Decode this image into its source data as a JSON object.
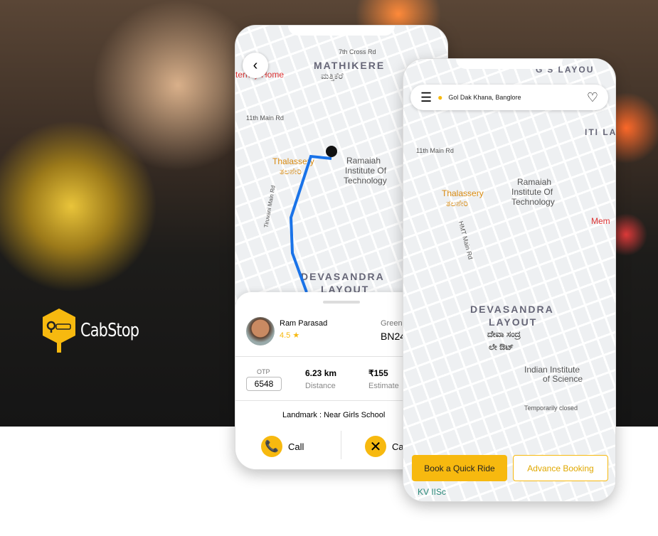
{
  "brand": {
    "name": "CabStop",
    "accent": "#f7b90f"
  },
  "phone1": {
    "map_labels": [
      "MATHIKERE",
      "ಮತ್ತಿಕೆರೆ",
      "Thalassery",
      "ತಲಶೇರಿ",
      "Ramaiah",
      "Institute Of",
      "Technology",
      "DEVASANDRA",
      "LAYOUT",
      "11th Main Rd",
      "7th Cross Rd",
      "Tiruvani Main Rd",
      "ternity Home"
    ],
    "driver": {
      "name": "Ram Parasad",
      "rating": "4.5",
      "car_color": "Green",
      "plate": "BN24"
    },
    "otp_label": "OTP",
    "otp": "6548",
    "distance": "6.23 km",
    "distance_label": "Distance",
    "estimate": "₹155",
    "estimate_label": "Estimate",
    "landmark": "Landmark : Near Girls School",
    "call_label": "Call",
    "cancel_label": "Ca"
  },
  "phone2": {
    "location": "Gol Dak Khana, Banglore",
    "map_labels": [
      "Thalassery",
      "ತಲಶೇರಿ",
      "Ramaiah",
      "Institute Of",
      "Technology",
      "DEVASANDRA",
      "LAYOUT",
      "ದೇವಾ ಸಂದ್ರ",
      "ಲೇ ಔಟ್",
      "Indian Institute",
      "of Science",
      "Temporarily closed",
      "HMT Main Rd",
      "ITI LAY",
      "Mem",
      "KV IISc",
      "11th Main Rd",
      "G'S LAYOU"
    ],
    "quick_ride": "Book a Quick Ride",
    "advance": "Advance Booking"
  }
}
